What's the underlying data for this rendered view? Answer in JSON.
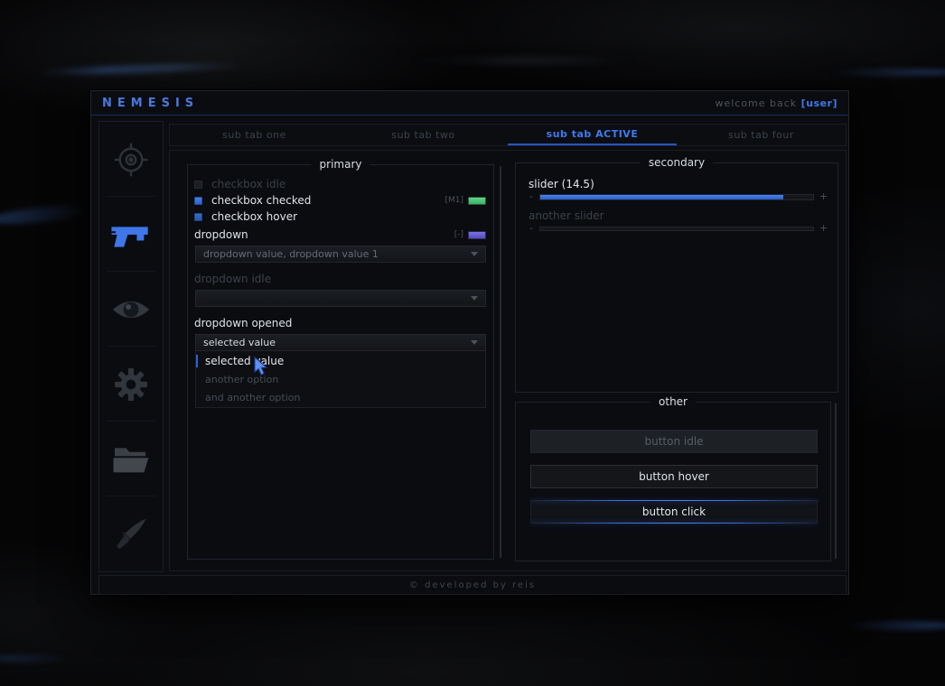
{
  "titlebar": {
    "app_title": "NEMESIS",
    "welcome_prefix": "welcome back",
    "welcome_user": "[user]"
  },
  "tabs": [
    {
      "label": "sub tab one",
      "active": false
    },
    {
      "label": "sub tab two",
      "active": false
    },
    {
      "label": "sub tab ACTIVE",
      "active": true
    },
    {
      "label": "sub tab four",
      "active": false
    }
  ],
  "sidebar": {
    "icons": [
      {
        "name": "crosshair-icon",
        "active": false
      },
      {
        "name": "pistol-icon",
        "active": true
      },
      {
        "name": "eye-icon",
        "active": false
      },
      {
        "name": "gear-icon",
        "active": false
      },
      {
        "name": "folder-icon",
        "active": false
      },
      {
        "name": "knife-icon",
        "active": false
      }
    ]
  },
  "primary": {
    "title": "primary",
    "checkboxes": [
      {
        "label": "checkbox idle",
        "state": "idle",
        "keybind": "",
        "keybind_color": ""
      },
      {
        "label": "checkbox checked",
        "state": "checked",
        "keybind": "[M1]",
        "keybind_color": "#41c773"
      },
      {
        "label": "checkbox hover",
        "state": "hover",
        "keybind": "",
        "keybind_color": ""
      }
    ],
    "dropdown_multi": {
      "label": "dropdown",
      "value": "dropdown value, dropdown value 1",
      "keybind": "[-]",
      "keybind_color": "#5d55d4"
    },
    "dropdown_idle": {
      "label": "dropdown idle",
      "value": ""
    },
    "dropdown_opened": {
      "label": "dropdown opened",
      "value": "selected value",
      "selected_index": 0,
      "options": [
        "selected value",
        "another option",
        "and another option"
      ]
    }
  },
  "secondary": {
    "title": "secondary",
    "sliders": [
      {
        "label": "slider (14.5)",
        "value": 14.5,
        "percent": 89,
        "minus": "-",
        "plus": "+",
        "state": "filled"
      },
      {
        "label": "another slider",
        "percent": 0,
        "minus": "-",
        "plus": "+",
        "state": "idle"
      }
    ]
  },
  "other": {
    "title": "other",
    "buttons": [
      {
        "label": "button idle",
        "state": "idle"
      },
      {
        "label": "button hover",
        "state": "hover"
      },
      {
        "label": "button click",
        "state": "click"
      }
    ]
  },
  "footer": {
    "text": "© developed by reis"
  },
  "colors": {
    "accent_blue": "#3f76e8",
    "active_tab": "#3f7af0",
    "tab_underline": "#2a52c4",
    "header_underline": "#1c2a5e",
    "checkbox_checked": "#3468d2",
    "keybind_green": "#41c773",
    "keybind_purple": "#5d55d4",
    "slider_fill": "#3b78ee",
    "button_click_glow": "#2f62d8"
  }
}
